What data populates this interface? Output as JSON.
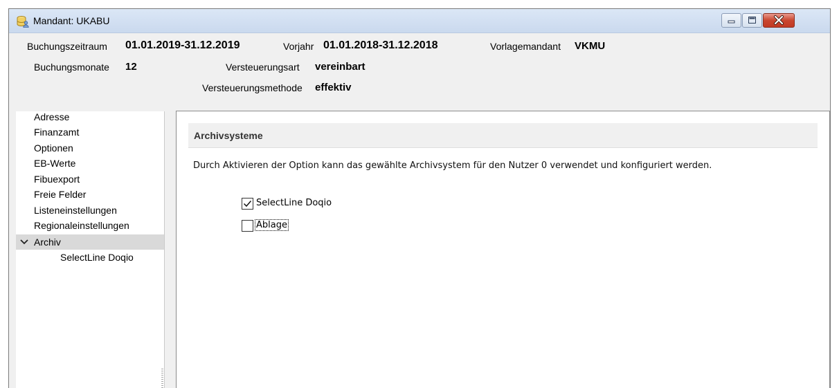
{
  "window": {
    "title": "Mandant: UKABU",
    "controls": {
      "minimize": "minimize",
      "maximize": "maximize",
      "close": "close"
    }
  },
  "header": {
    "buchungszeitraum_label": "Buchungszeitraum",
    "buchungszeitraum_value": "01.01.2019-31.12.2019",
    "vorjahr_label": "Vorjahr",
    "vorjahr_value": "01.01.2018-31.12.2018",
    "vorlagemandant_label": "Vorlagemandant",
    "vorlagemandant_value": "VKMU",
    "buchungsmonate_label": "Buchungsmonate",
    "buchungsmonate_value": "12",
    "versteuerungsart_label": "Versteuerungsart",
    "versteuerungsart_value": "vereinbart",
    "versteuerungsmethode_label": "Versteuerungsmethode",
    "versteuerungsmethode_value": "effektiv"
  },
  "sidebar": {
    "items": [
      {
        "label": "Adresse"
      },
      {
        "label": "Finanzamt"
      },
      {
        "label": "Optionen"
      },
      {
        "label": "EB-Werte"
      },
      {
        "label": "Fibuexport"
      },
      {
        "label": "Freie Felder"
      },
      {
        "label": "Listeneinstellungen"
      },
      {
        "label": "Regionaleinstellungen"
      },
      {
        "label": "Archiv",
        "selected": true,
        "expanded": true,
        "children": [
          {
            "label": "SelectLine Doqio"
          }
        ]
      }
    ]
  },
  "content": {
    "section_title": "Archivsysteme",
    "description": "Durch Aktivieren der Option kann das gewählte Archivsystem für den Nutzer  0 verwendet und konfiguriert werden.",
    "options": [
      {
        "label": "SelectLine Doqio",
        "checked": true
      },
      {
        "label": "Ablage",
        "checked": false,
        "focused": true
      }
    ]
  },
  "colors": {
    "titlebar": "#cad9ee",
    "window_bg": "#f0f0f0",
    "selected_row": "#d9d9d9",
    "close_button": "#c9462f"
  },
  "icons": {
    "app": "database-user-icon",
    "expand": "chevron-down-icon",
    "check": "check-icon"
  }
}
